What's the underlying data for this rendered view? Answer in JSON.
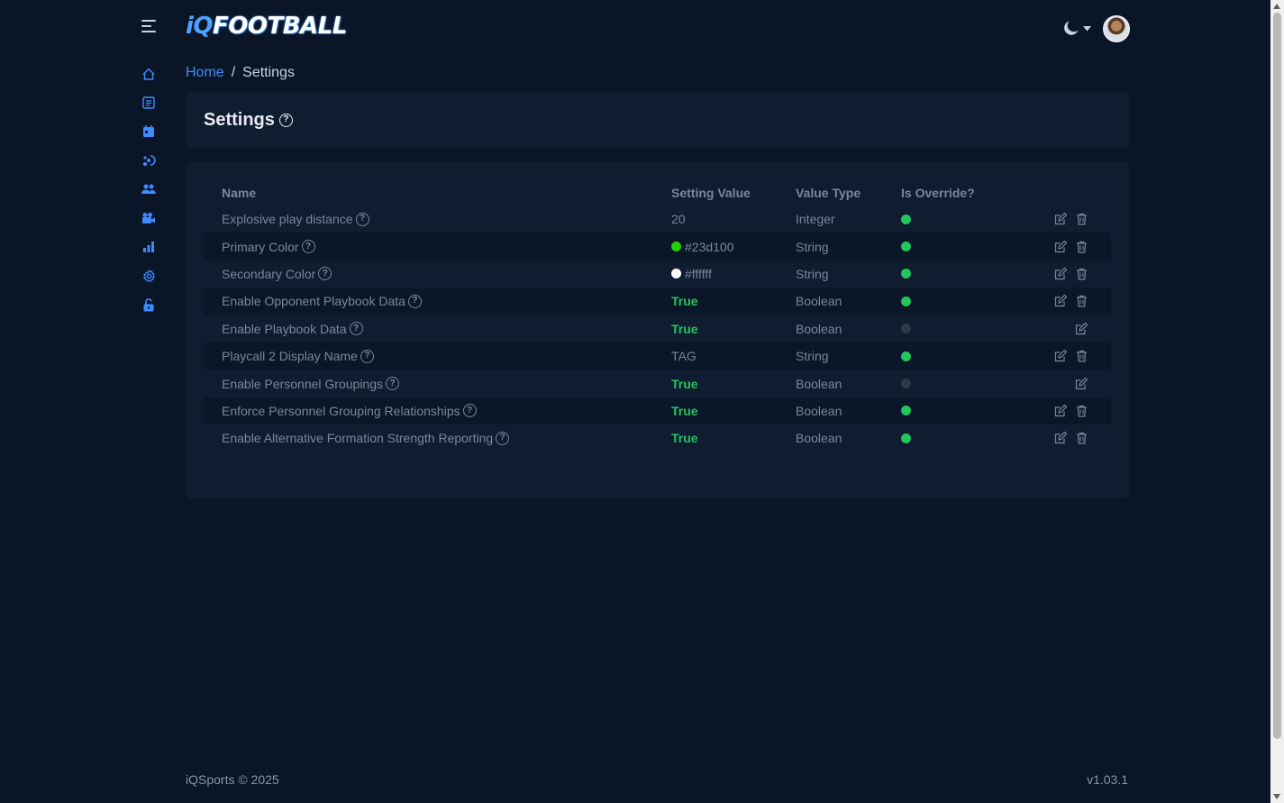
{
  "header": {
    "logo_iq": "iQ",
    "logo_football": "FOOTBALL"
  },
  "breadcrumb": {
    "home": "Home",
    "separator": "/",
    "current": "Settings"
  },
  "page": {
    "title": "Settings"
  },
  "table": {
    "columns": {
      "name": "Name",
      "value": "Setting Value",
      "type": "Value Type",
      "override": "Is Override?"
    },
    "rows": [
      {
        "name": "Explosive play distance",
        "value": "20",
        "type": "Integer"
      },
      {
        "name": "Primary Color",
        "value": "#23d100",
        "type": "String"
      },
      {
        "name": "Secondary Color",
        "value": "#ffffff",
        "type": "String"
      },
      {
        "name": "Enable Opponent Playbook Data",
        "value": "True",
        "type": "Boolean"
      },
      {
        "name": "Enable Playbook Data",
        "value": "True",
        "type": "Boolean"
      },
      {
        "name": "Playcall 2 Display Name",
        "value": "TAG",
        "type": "String"
      },
      {
        "name": "Enable Personnel Groupings",
        "value": "True",
        "type": "Boolean"
      },
      {
        "name": "Enforce Personnel Grouping Relationships",
        "value": "True",
        "type": "Boolean"
      },
      {
        "name": "Enable Alternative Formation Strength Reporting",
        "value": "True",
        "type": "Boolean"
      }
    ]
  },
  "footer": {
    "copyright": "iQSports © 2025",
    "version": "v1.03.1"
  },
  "colors": {
    "background": "#0a1628",
    "card": "#101d30",
    "accent": "#3d8bfd",
    "true_green": "#22c55e",
    "override_on": "#22c55e",
    "override_off": "#2f3a48"
  },
  "icons": {
    "sidebar": [
      "home-icon",
      "playbook-icon",
      "calendar-icon",
      "plays-icon",
      "users-icon",
      "film-icon",
      "chart-icon",
      "settings-icon",
      "lock-icon"
    ],
    "row_actions": [
      "edit-icon",
      "trash-icon"
    ]
  }
}
